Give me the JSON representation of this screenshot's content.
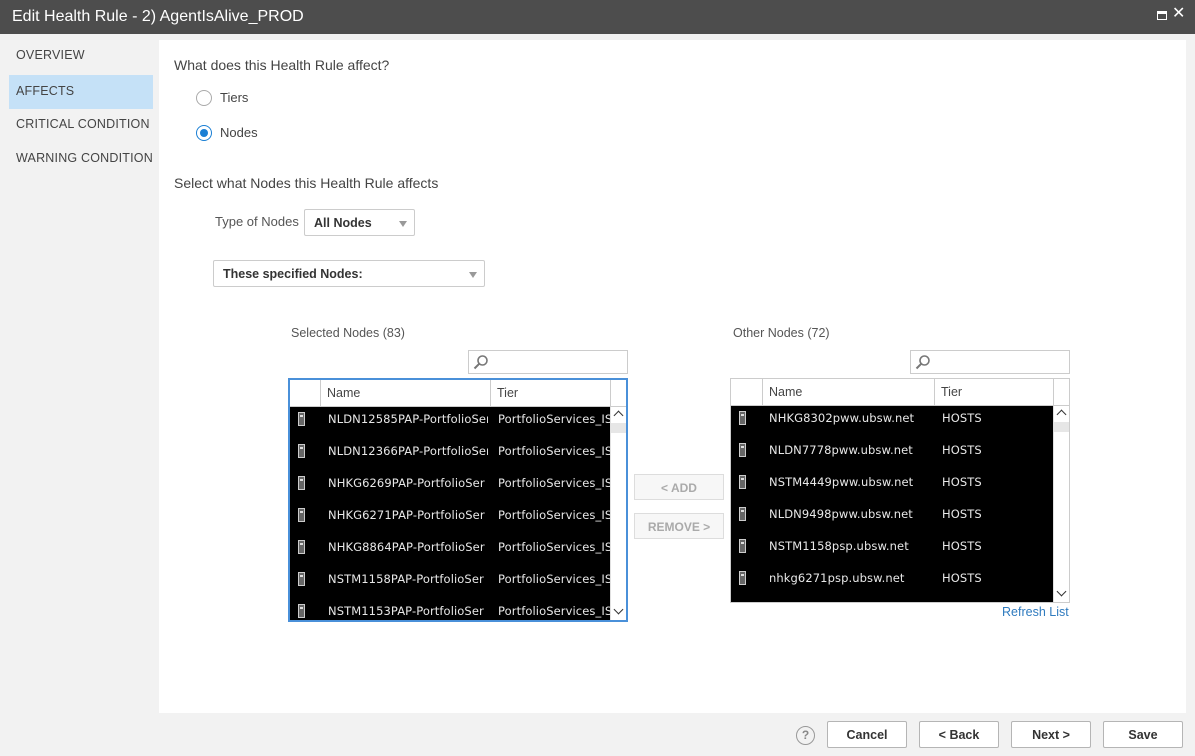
{
  "window": {
    "title": "Edit Health Rule - 2) AgentIsAlive_PROD"
  },
  "sidebar": {
    "items": [
      {
        "label": "OVERVIEW",
        "active": false
      },
      {
        "label": "AFFECTS",
        "active": true
      },
      {
        "label": "CRITICAL CONDITION",
        "active": false
      },
      {
        "label": "WARNING CONDITION",
        "active": false
      }
    ]
  },
  "affects": {
    "question": "What does this Health Rule affect?",
    "options": [
      {
        "label": "Tiers",
        "selected": false
      },
      {
        "label": "Nodes",
        "selected": true
      }
    ],
    "nodes_title": "Select what Nodes this Health Rule affects",
    "type_of_nodes_label": "Type of Nodes",
    "type_of_nodes_value": "All Nodes",
    "scope_value": "These specified Nodes:"
  },
  "selected_nodes": {
    "title": "Selected Nodes (83)",
    "search_placeholder": "",
    "columns": [
      "Name",
      "Tier"
    ],
    "rows": [
      {
        "name": "NLDN12585PAP-PortfolioSer",
        "tier": "PortfolioServices_IS"
      },
      {
        "name": "NLDN12366PAP-PortfolioSer",
        "tier": "PortfolioServices_IS"
      },
      {
        "name": "NHKG6269PAP-PortfolioSer",
        "tier": "PortfolioServices_IS"
      },
      {
        "name": "NHKG6271PAP-PortfolioSer",
        "tier": "PortfolioServices_IS"
      },
      {
        "name": "NHKG8864PAP-PortfolioSer",
        "tier": "PortfolioServices_IS"
      },
      {
        "name": "NSTM1158PAP-PortfolioSer",
        "tier": "PortfolioServices_IS"
      },
      {
        "name": "NSTM1153PAP-PortfolioSer",
        "tier": "PortfolioServices_IS"
      }
    ]
  },
  "transfer": {
    "add_label": "< ADD",
    "remove_label": "REMOVE >"
  },
  "other_nodes": {
    "title": "Other Nodes (72)",
    "search_placeholder": "",
    "columns": [
      "Name",
      "Tier"
    ],
    "rows": [
      {
        "name": "NHKG8302pww.ubsw.net",
        "tier": "HOSTS"
      },
      {
        "name": "NLDN7778pww.ubsw.net",
        "tier": "HOSTS"
      },
      {
        "name": "NSTM4449pww.ubsw.net",
        "tier": "HOSTS"
      },
      {
        "name": "NLDN9498pww.ubsw.net",
        "tier": "HOSTS"
      },
      {
        "name": "NSTM1158psp.ubsw.net",
        "tier": "HOSTS"
      },
      {
        "name": "nhkg6271psp.ubsw.net",
        "tier": "HOSTS"
      }
    ],
    "refresh_label": "Refresh List"
  },
  "footer": {
    "help_icon": "question-circle-icon",
    "cancel_label": "Cancel",
    "back_label": "< Back",
    "next_label": "Next >",
    "save_label": "Save"
  },
  "colors": {
    "accent": "#1a7fd4",
    "nav_active": "#c5e1f7",
    "titlebar": "#4d4d4d",
    "link": "#2f7bbf"
  }
}
